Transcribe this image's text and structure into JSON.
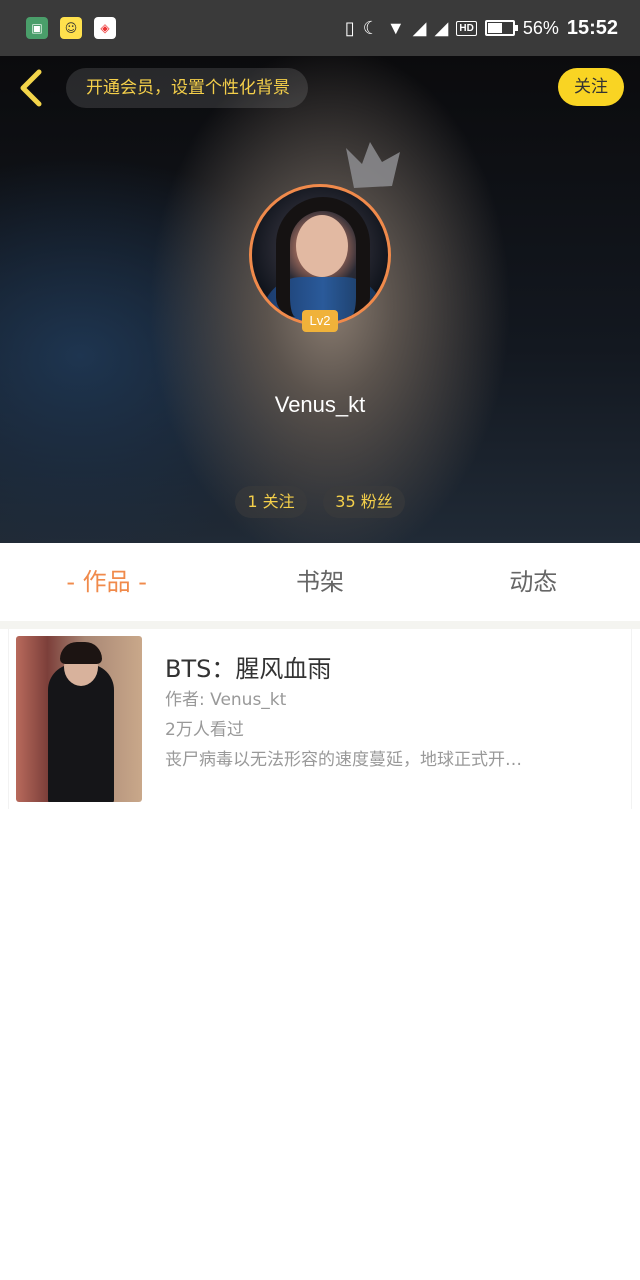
{
  "status_bar": {
    "battery_percent": "56%",
    "battery_level": 0.56,
    "time": "15:52",
    "hd_label": "HD"
  },
  "header": {
    "vip_banner": "开通会员，设置个性化背景",
    "follow_label": "关注",
    "level_badge": "Lv2",
    "username": "Venus_kt",
    "following": "1 关注",
    "fans": "35 粉丝"
  },
  "tabs": [
    {
      "label": "- 作品 -",
      "active": true
    },
    {
      "label": "书架",
      "active": false
    },
    {
      "label": "动态",
      "active": false
    }
  ],
  "books": [
    {
      "title": "BTS：腥风血雨",
      "author": "作者: Venus_kt",
      "views": "2万人看过",
      "description": "丧尸病毒以无法形容的速度蔓延，地球正式开…"
    }
  ],
  "colors": {
    "accent": "#f08a4b",
    "gold": "#f4cf4a",
    "follow_button": "#f9d423",
    "status_bar": "#3a3a3a"
  }
}
